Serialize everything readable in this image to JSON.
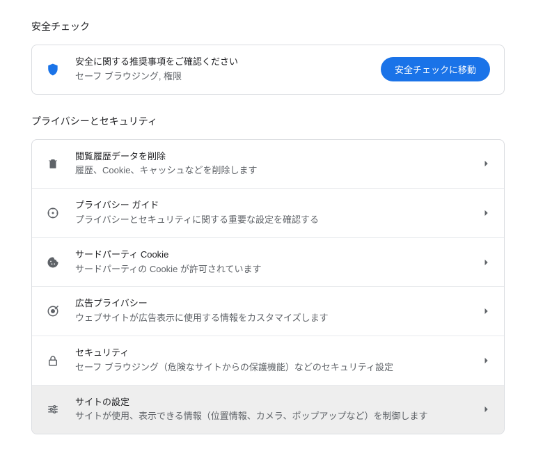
{
  "safety_check": {
    "section_title": "安全チェック",
    "title": "安全に関する推奨事項をご確認ください",
    "subtitle": "セーフ ブラウジング, 権限",
    "button_label": "安全チェックに移動"
  },
  "privacy": {
    "section_title": "プライバシーとセキュリティ",
    "items": [
      {
        "icon": "trash-icon",
        "title": "閲覧履歴データを削除",
        "subtitle": "履歴、Cookie、キャッシュなどを削除します"
      },
      {
        "icon": "compass-icon",
        "title": "プライバシー ガイド",
        "subtitle": "プライバシーとセキュリティに関する重要な設定を確認する"
      },
      {
        "icon": "cookie-icon",
        "title": "サードパーティ Cookie",
        "subtitle": "サードパーティの Cookie が許可されています"
      },
      {
        "icon": "target-icon",
        "title": "広告プライバシー",
        "subtitle": "ウェブサイトが広告表示に使用する情報をカスタマイズします"
      },
      {
        "icon": "lock-icon",
        "title": "セキュリティ",
        "subtitle": "セーフ ブラウジング（危険なサイトからの保護機能）などのセキュリティ設定"
      },
      {
        "icon": "tune-icon",
        "title": "サイトの設定",
        "subtitle": "サイトが使用、表示できる情報（位置情報、カメラ、ポップアップなど）を制御します"
      }
    ]
  },
  "colors": {
    "primary": "#1a73e8",
    "text": "#202124",
    "subtext": "#5f6368",
    "border": "#dadce0"
  }
}
